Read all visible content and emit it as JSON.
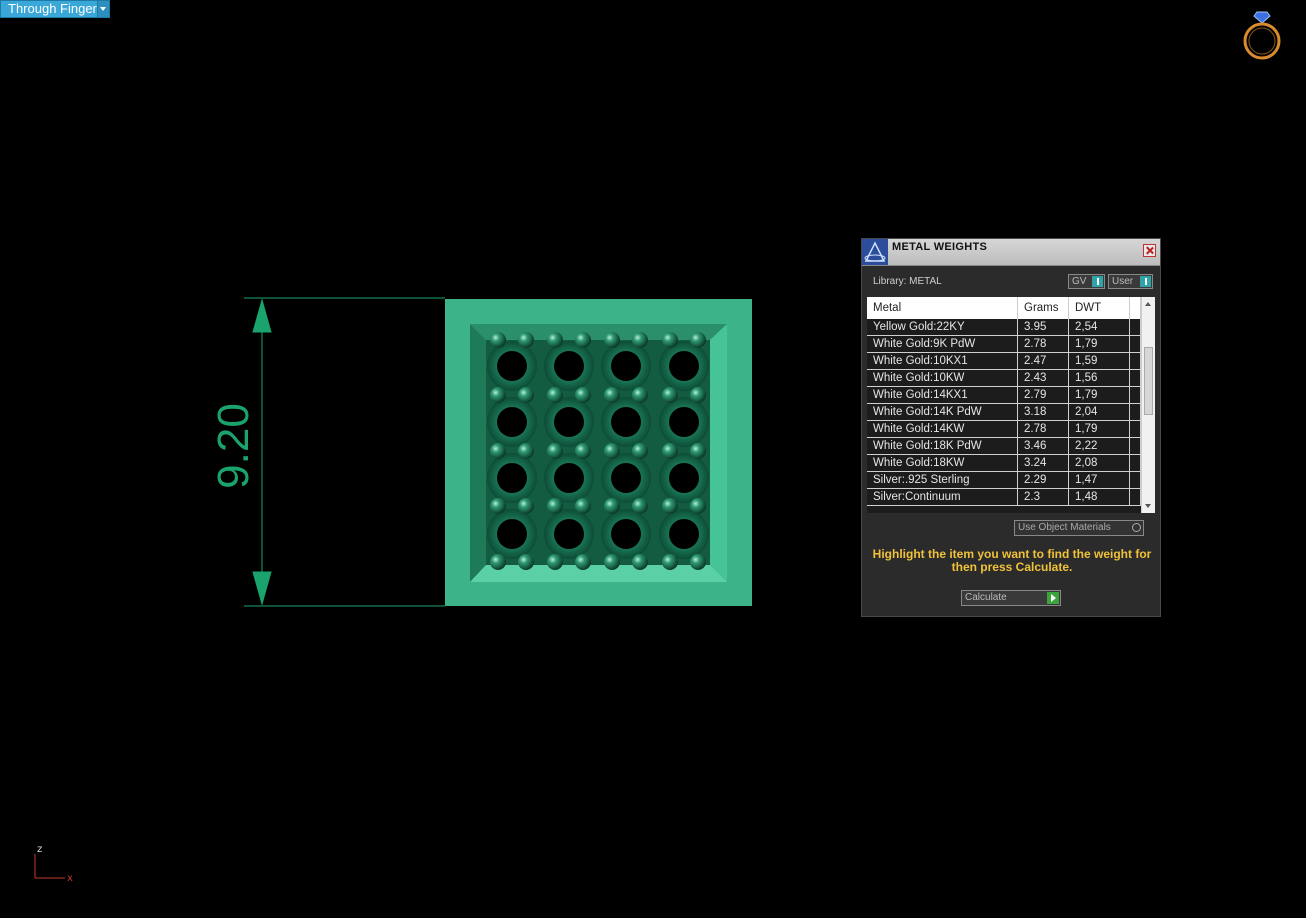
{
  "viewport": {
    "view_name": "Through Finger"
  },
  "dimension": {
    "value": "9.20"
  },
  "axis": {
    "z_label": "z",
    "x_label": "x"
  },
  "panel": {
    "title": "METAL WEIGHTS",
    "library_label": "Library: METAL",
    "gv_label": "GV",
    "user_label": "User",
    "columns": [
      "Metal",
      "Grams",
      "DWT"
    ],
    "rows": [
      [
        "Yellow Gold:22KY",
        "3.95",
        "2,54"
      ],
      [
        "White Gold:9K PdW",
        "2.78",
        "1,79"
      ],
      [
        "White Gold:10KX1",
        "2.47",
        "1,59"
      ],
      [
        "White Gold:10KW",
        "2.43",
        "1,56"
      ],
      [
        "White Gold:14KX1",
        "2.79",
        "1,79"
      ],
      [
        "White Gold:14K PdW",
        "3.18",
        "2,04"
      ],
      [
        "White Gold:14KW",
        "2.78",
        "1,79"
      ],
      [
        "White Gold:18K PdW",
        "3.46",
        "2,22"
      ],
      [
        "White Gold:18KW",
        "3.24",
        "2,08"
      ],
      [
        "Silver:.925 Sterling",
        "2.29",
        "1,47"
      ],
      [
        "Silver:Continuum",
        "2.3",
        "1,48"
      ]
    ],
    "use_object_materials": "Use Object Materials",
    "hint": "Highlight the item you want to find the weight for then press Calculate.",
    "calculate_label": "Calculate"
  },
  "colors": {
    "model_green": "#3db38a",
    "dim_green": "#1aa36c",
    "accent_blue": "#39a7d8"
  }
}
